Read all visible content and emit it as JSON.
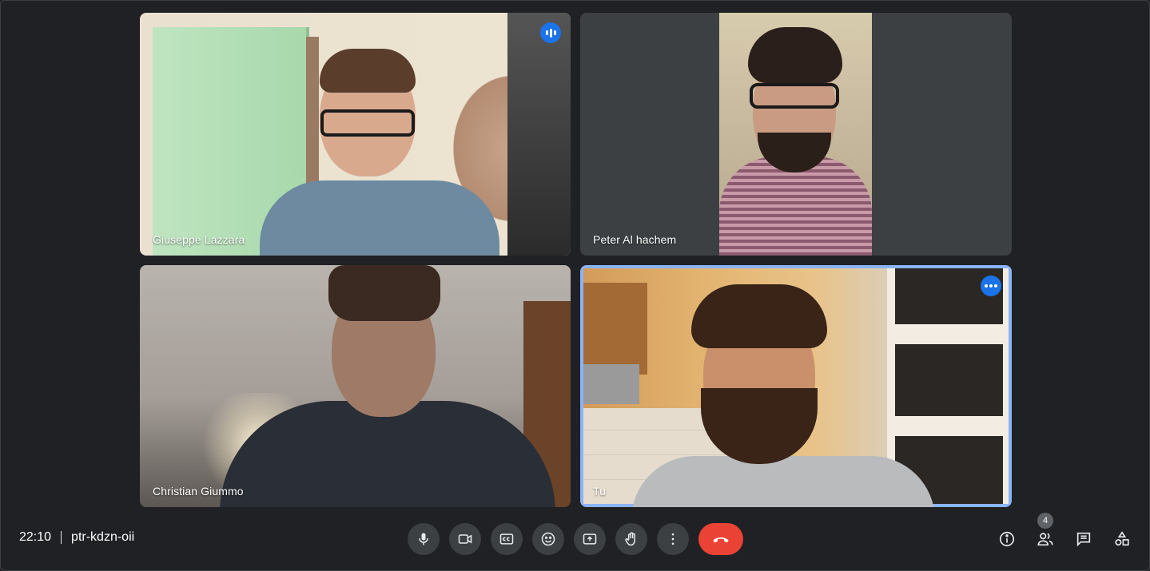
{
  "meeting": {
    "time": "22:10",
    "code": "ptr-kdzn-oii"
  },
  "participants": [
    {
      "name": "Giuseppe Lazzara",
      "speaking": true
    },
    {
      "name": "Peter Al hachem",
      "speaking": false
    },
    {
      "name": "Christian Giummo",
      "speaking": false
    },
    {
      "name": "Tu",
      "speaking": false,
      "self": true
    }
  ],
  "controls": [
    {
      "icon": "microphone-icon"
    },
    {
      "icon": "camera-icon"
    },
    {
      "icon": "captions-icon"
    },
    {
      "icon": "emoji-icon"
    },
    {
      "icon": "present-screen-icon"
    },
    {
      "icon": "raise-hand-icon"
    },
    {
      "icon": "more-options-icon"
    },
    {
      "icon": "end-call-icon"
    }
  ],
  "right_tools": {
    "people_count": "4",
    "icons": [
      "info-icon",
      "people-icon",
      "chat-icon",
      "activities-icon"
    ]
  },
  "colors": {
    "background": "#202124",
    "button": "#3c4043",
    "end_call": "#ea4335",
    "accent": "#1a73e8",
    "self_border": "#8ab4f8"
  }
}
